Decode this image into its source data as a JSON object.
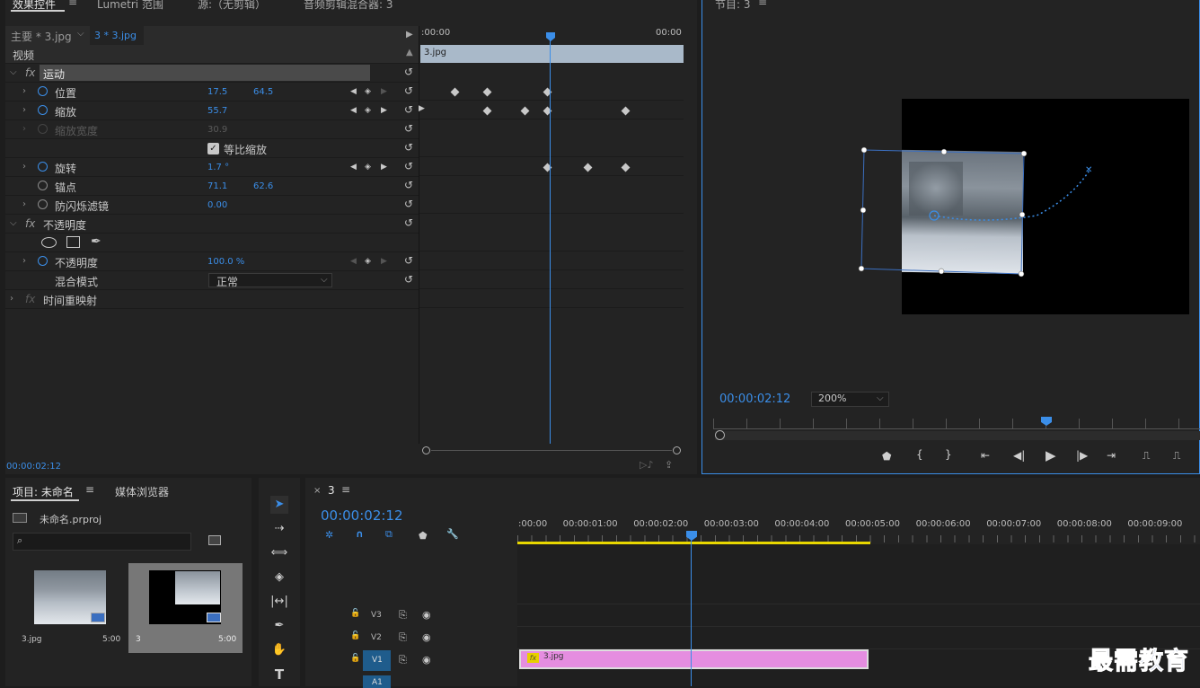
{
  "tabs": {
    "effect_controls": "效果控件",
    "lumetri": "Lumetri 范围",
    "source": "源:（无剪辑）",
    "audio_mixer": "音频剪辑混合器: 3"
  },
  "program": {
    "title": "节目: 3",
    "timecode": "00:00:02:12",
    "zoom": "200%"
  },
  "effects": {
    "master_clip": "主要 * 3.jpg",
    "seq_clip": "3 * 3.jpg",
    "section_video": "视频",
    "ruler_start": ":00:00",
    "ruler_end": "00:00",
    "clip_bar": "3.jpg",
    "motion": "运动",
    "position": {
      "label": "位置",
      "x": "17.5",
      "y": "64.5"
    },
    "scale": {
      "label": "缩放",
      "value": "55.7"
    },
    "scale_width": {
      "label": "缩放宽度",
      "value": "30.9"
    },
    "uniform": "等比缩放",
    "rotation": {
      "label": "旋转",
      "value": "1.7 °"
    },
    "anchor": {
      "label": "锚点",
      "x": "71.1",
      "y": "62.6"
    },
    "antiflicker": {
      "label": "防闪烁滤镜",
      "value": "0.00"
    },
    "opacity_group": "不透明度",
    "opacity": {
      "label": "不透明度",
      "value": "100.0 %"
    },
    "blend": {
      "label": "混合模式",
      "value": "正常"
    },
    "remap": "时间重映射",
    "timecode": "00:00:02:12"
  },
  "project": {
    "tab_project": "项目: 未命名",
    "tab_media": "媒体浏览器",
    "file": "未命名.prproj",
    "search_placeholder": "",
    "items": [
      {
        "name": "3.jpg",
        "dur": "5:00"
      },
      {
        "name": "3",
        "dur": "5:00"
      }
    ]
  },
  "timeline": {
    "seq_tab": "3",
    "timecode": "00:00:02:12",
    "ruler": [
      ":00:00",
      "00:00:01:00",
      "00:00:02:00",
      "00:00:03:00",
      "00:00:04:00",
      "00:00:05:00",
      "00:00:06:00",
      "00:00:07:00",
      "00:00:08:00",
      "00:00:09:00"
    ],
    "tracks": [
      "V3",
      "V2",
      "V1",
      "A1"
    ],
    "clip": "3.jpg",
    "fx": "fx"
  },
  "watermark": "最需教育",
  "colors": {
    "accent": "#3b8ee8",
    "clip": "#e58de0",
    "workarea": "#e8d700"
  }
}
